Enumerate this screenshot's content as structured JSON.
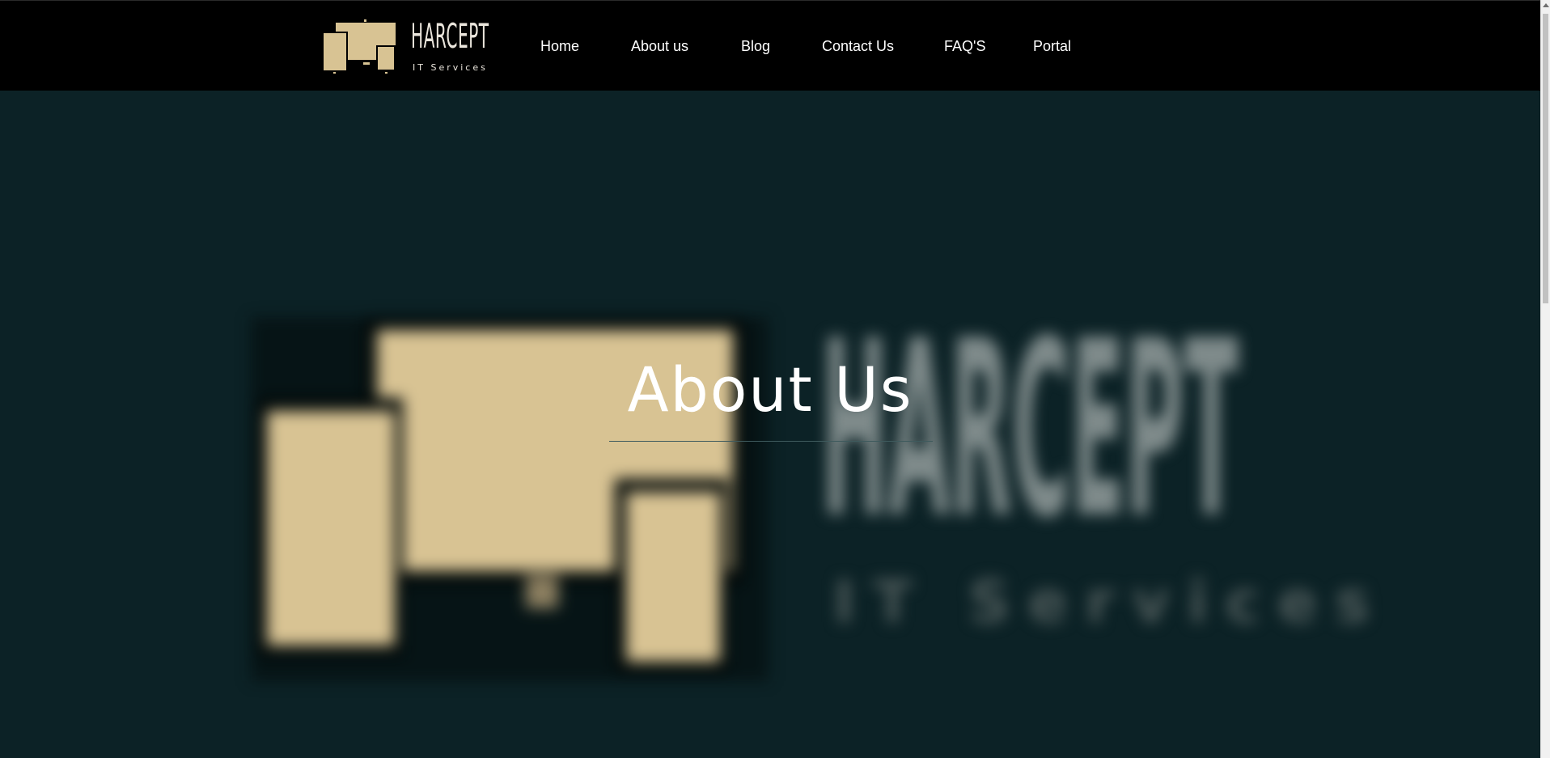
{
  "site": {
    "brand_name": "Harcept",
    "brand_tagline": "IT Services",
    "colors": {
      "header_bg": "#000000",
      "hero_bg": "#0c2226",
      "logo_tan": "#d8c393",
      "nav_text": "#ffffff"
    }
  },
  "nav": {
    "items": [
      {
        "label": "Home"
      },
      {
        "label": "About us"
      },
      {
        "label": "Blog"
      },
      {
        "label": "Contact Us"
      },
      {
        "label": "FAQ'S"
      },
      {
        "label": "Portal"
      }
    ]
  },
  "hero": {
    "title": "About Us",
    "background_brand_name": "Harcept",
    "background_brand_tagline": "IT Services"
  },
  "icons": {
    "logo": "devices-logo-icon",
    "scroll_up": "scroll-up-arrow-icon"
  }
}
